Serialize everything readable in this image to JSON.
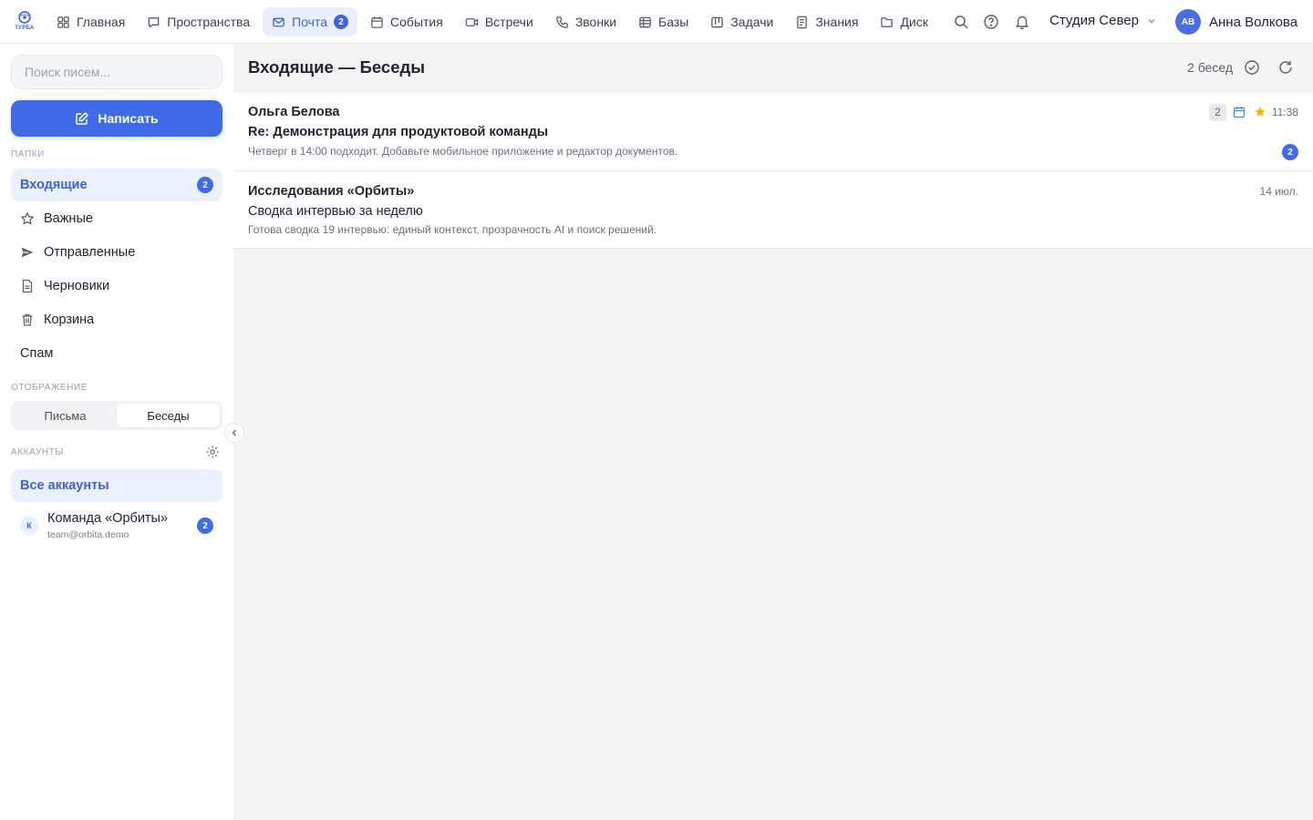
{
  "app": {
    "logo_text": "ТУРБА"
  },
  "nav": [
    {
      "label": "Главная",
      "icon": "grid-icon"
    },
    {
      "label": "Пространства",
      "icon": "chat-icon"
    },
    {
      "label": "Почта",
      "icon": "mail-icon",
      "badge": "2",
      "active": true
    },
    {
      "label": "События",
      "icon": "calendar-icon"
    },
    {
      "label": "Встречи",
      "icon": "video-icon"
    },
    {
      "label": "Звонки",
      "icon": "phone-icon"
    },
    {
      "label": "Базы",
      "icon": "table-icon"
    },
    {
      "label": "Задачи",
      "icon": "kanban-icon"
    },
    {
      "label": "Знания",
      "icon": "book-icon"
    },
    {
      "label": "Диск",
      "icon": "folder-icon"
    }
  ],
  "topbar": {
    "workspace": "Студия Север",
    "user": {
      "initials": "АВ",
      "name": "Анна Волкова"
    }
  },
  "sidebar": {
    "search_placeholder": "Поиск писем...",
    "compose_label": "Написать",
    "folders_title": "Папки",
    "folders": [
      {
        "label": "Входящие",
        "badge": "2",
        "active": true
      },
      {
        "label": "Важные",
        "icon": "star-icon"
      },
      {
        "label": "Отправленные",
        "icon": "send-icon"
      },
      {
        "label": "Черновики",
        "icon": "draft-icon"
      },
      {
        "label": "Корзина",
        "icon": "trash-icon"
      },
      {
        "label": "Спам"
      }
    ],
    "view_title": "Отображение",
    "view_options": [
      {
        "label": "Письма",
        "active": false
      },
      {
        "label": "Беседы",
        "active": true
      }
    ],
    "accounts_title": "Аккаунты",
    "all_accounts": "Все аккаунты",
    "account": {
      "initial": "К",
      "name": "Команда «Орбиты»",
      "email": "team@orbita.demo",
      "badge": "2"
    }
  },
  "main": {
    "title": "Входящие — Беседы",
    "count": "2 бесед",
    "mails": [
      {
        "sender": "Ольга Белова",
        "subject": "Re: Демонстрация для продуктовой команды",
        "snippet": "Четверг в 14:00 подходит. Добавьте мобильное приложение и редактор документов.",
        "time": "11:38",
        "thread_count": "2",
        "unread": "2",
        "starred": true
      },
      {
        "sender": "Исследования «Орбиты»",
        "subject": "Сводка интервью за неделю",
        "snippet": "Готова сводка 19 интервью: единый контекст, прозрачность AI и поиск решений.",
        "time": "14 июл."
      }
    ]
  },
  "colors": {
    "accent": "#3f6ae8",
    "star": "#f2b900",
    "calendar": "#3b8fe0"
  }
}
